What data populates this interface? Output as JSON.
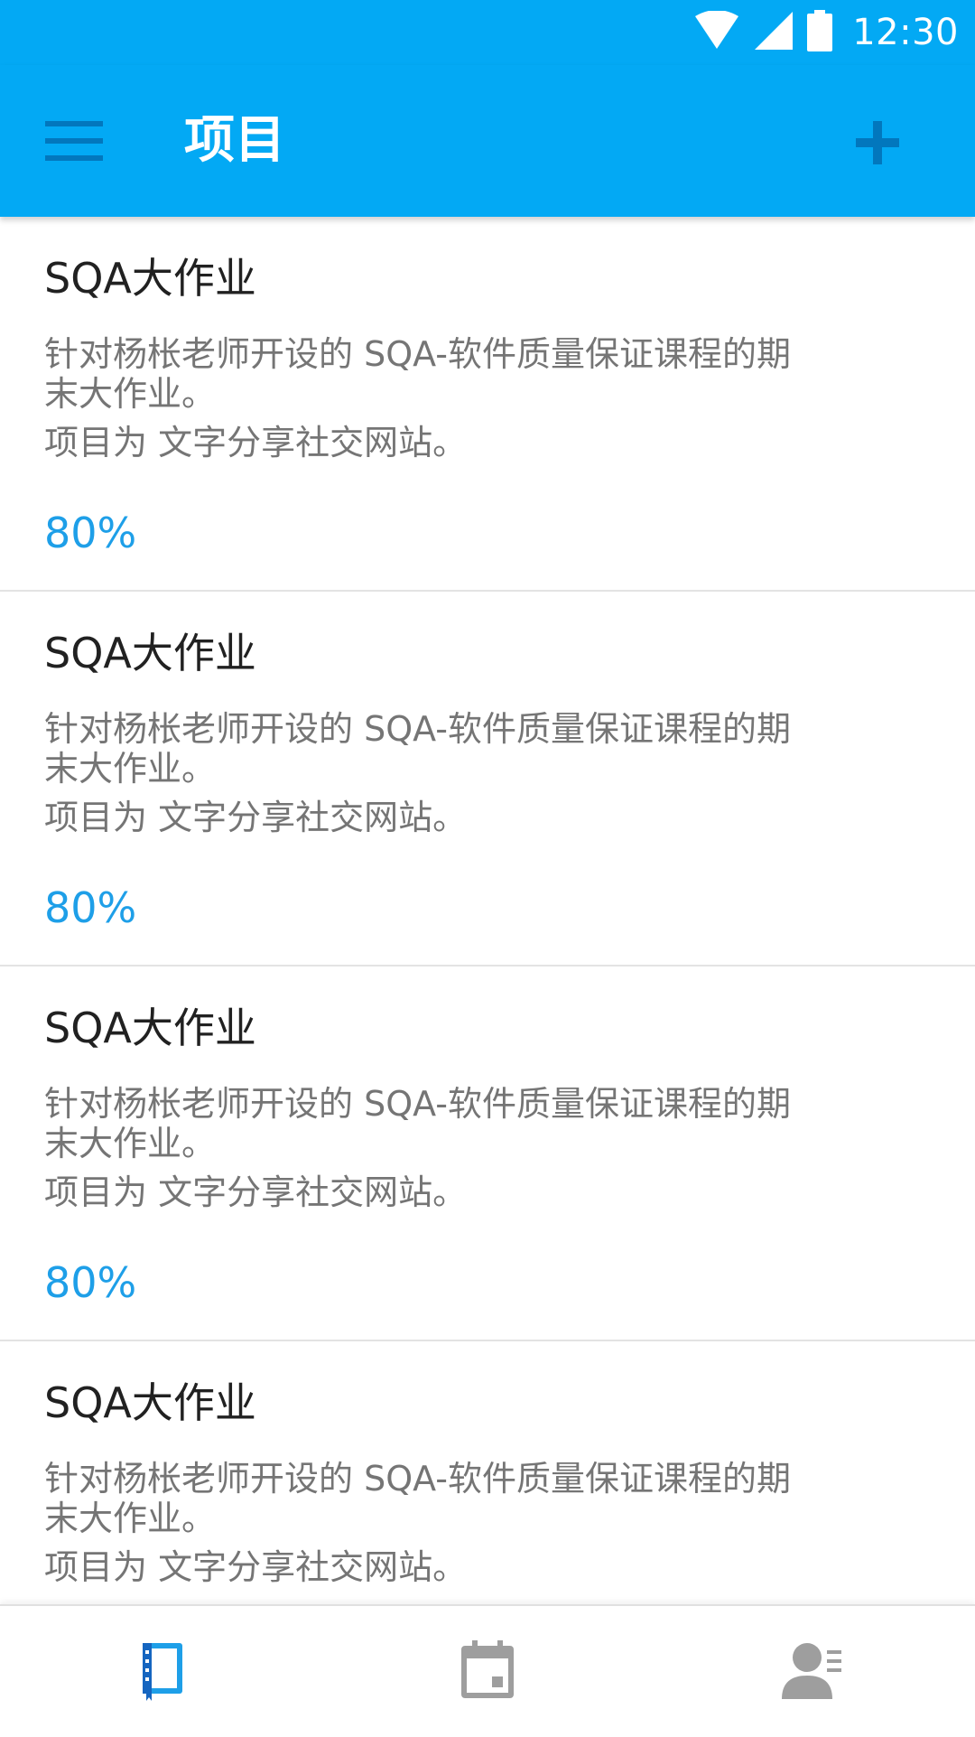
{
  "status_bar": {
    "time": "12:30",
    "icons": [
      "wifi-icon",
      "cell-signal-icon",
      "battery-icon"
    ]
  },
  "app_bar": {
    "title": "项目",
    "menu_icon": "menu-icon",
    "add_icon": "add-icon"
  },
  "projects": [
    {
      "title": "SQA大作业",
      "description_line1": "针对杨枨老师开设的 SQA-软件质量保证课程的期末大作业。",
      "description_line2": "项目为 文字分享社交网站。",
      "progress": "80%"
    },
    {
      "title": "SQA大作业",
      "description_line1": "针对杨枨老师开设的 SQA-软件质量保证课程的期末大作业。",
      "description_line2": "项目为 文字分享社交网站。",
      "progress": "80%"
    },
    {
      "title": "SQA大作业",
      "description_line1": "针对杨枨老师开设的 SQA-软件质量保证课程的期末大作业。",
      "description_line2": "项目为 文字分享社交网站。",
      "progress": "80%"
    },
    {
      "title": "SQA大作业",
      "description_line1": "针对杨枨老师开设的 SQA-软件质量保证课程的期末大作业。",
      "description_line2": "项目为 文字分享社交网站。",
      "progress": ""
    }
  ],
  "bottom_nav": {
    "items": [
      {
        "icon": "notebook-icon",
        "active": true
      },
      {
        "icon": "calendar-icon",
        "active": false
      },
      {
        "icon": "contacts-icon",
        "active": false
      }
    ]
  },
  "colors": {
    "primary": "#03A9F4",
    "accent": "#1E9FE8",
    "inactive_icon": "#9E9E9E",
    "title_text": "#212121",
    "secondary_text": "#757575"
  }
}
